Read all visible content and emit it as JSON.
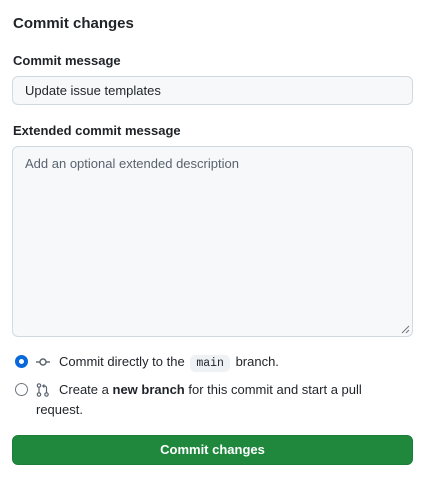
{
  "dialog": {
    "title": "Commit changes"
  },
  "commit_message": {
    "label": "Commit message",
    "value": "Update issue templates"
  },
  "extended_message": {
    "label": "Extended commit message",
    "placeholder": "Add an optional extended description"
  },
  "options": {
    "direct": {
      "selected": true,
      "icon": "git-commit-icon",
      "prefix": "Commit directly to the",
      "branch": "main",
      "suffix": "branch."
    },
    "new_branch": {
      "selected": false,
      "icon": "git-pull-request-icon",
      "prefix": "Create a",
      "emphasis": "new branch",
      "suffix": "for this commit and start a pull",
      "continuation": "request."
    }
  },
  "submit_button": {
    "label": "Commit changes"
  },
  "colors": {
    "accent_blue": "#0969da",
    "button_green": "#1f883d",
    "field_background": "#f6f8fa"
  }
}
